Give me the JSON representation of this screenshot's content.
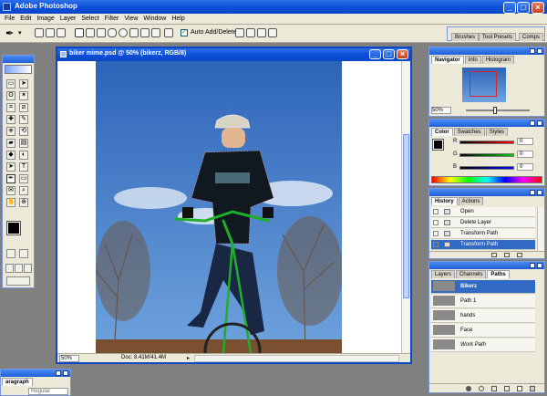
{
  "app": {
    "title": "Adobe Photoshop"
  },
  "menu": [
    "File",
    "Edit",
    "Image",
    "Layer",
    "Select",
    "Filter",
    "View",
    "Window",
    "Help"
  ],
  "options_bar": {
    "auto_add_delete_label": "Auto Add/Delete",
    "auto_add_delete_checked": true
  },
  "palette_well": {
    "tabs": [
      "Brushes",
      "Tool Presets",
      "Comps"
    ]
  },
  "document": {
    "title": "biker mime.psd @ 50% (bikerz, RGB/8)",
    "zoom": "50%",
    "doc_info": "Doc: 8.41M/41.4M"
  },
  "navigator": {
    "tabs": [
      "Navigator",
      "Info",
      "Histogram"
    ],
    "zoom": "50%"
  },
  "color": {
    "tabs": [
      "Color",
      "Swatches",
      "Styles"
    ],
    "channels": [
      {
        "label": "R",
        "value": "0"
      },
      {
        "label": "G",
        "value": "0"
      },
      {
        "label": "B",
        "value": "0"
      }
    ]
  },
  "history": {
    "tabs": [
      "History",
      "Actions"
    ],
    "items": [
      "Open",
      "Delete Layer",
      "Transform Path",
      "Transform Path"
    ],
    "selected_index": 3
  },
  "paths": {
    "tabs": [
      "Layers",
      "Channels",
      "Paths"
    ],
    "items": [
      "Bikerz",
      "Path 1",
      "hands",
      "Face",
      "Work Path"
    ],
    "selected_index": 0
  },
  "character": {
    "tab": "aragraph",
    "font_style": "Regular"
  },
  "colors": {
    "accent": "#0b4fd9",
    "menu_bg": "#ece9d8",
    "selection": "#316ac5"
  }
}
